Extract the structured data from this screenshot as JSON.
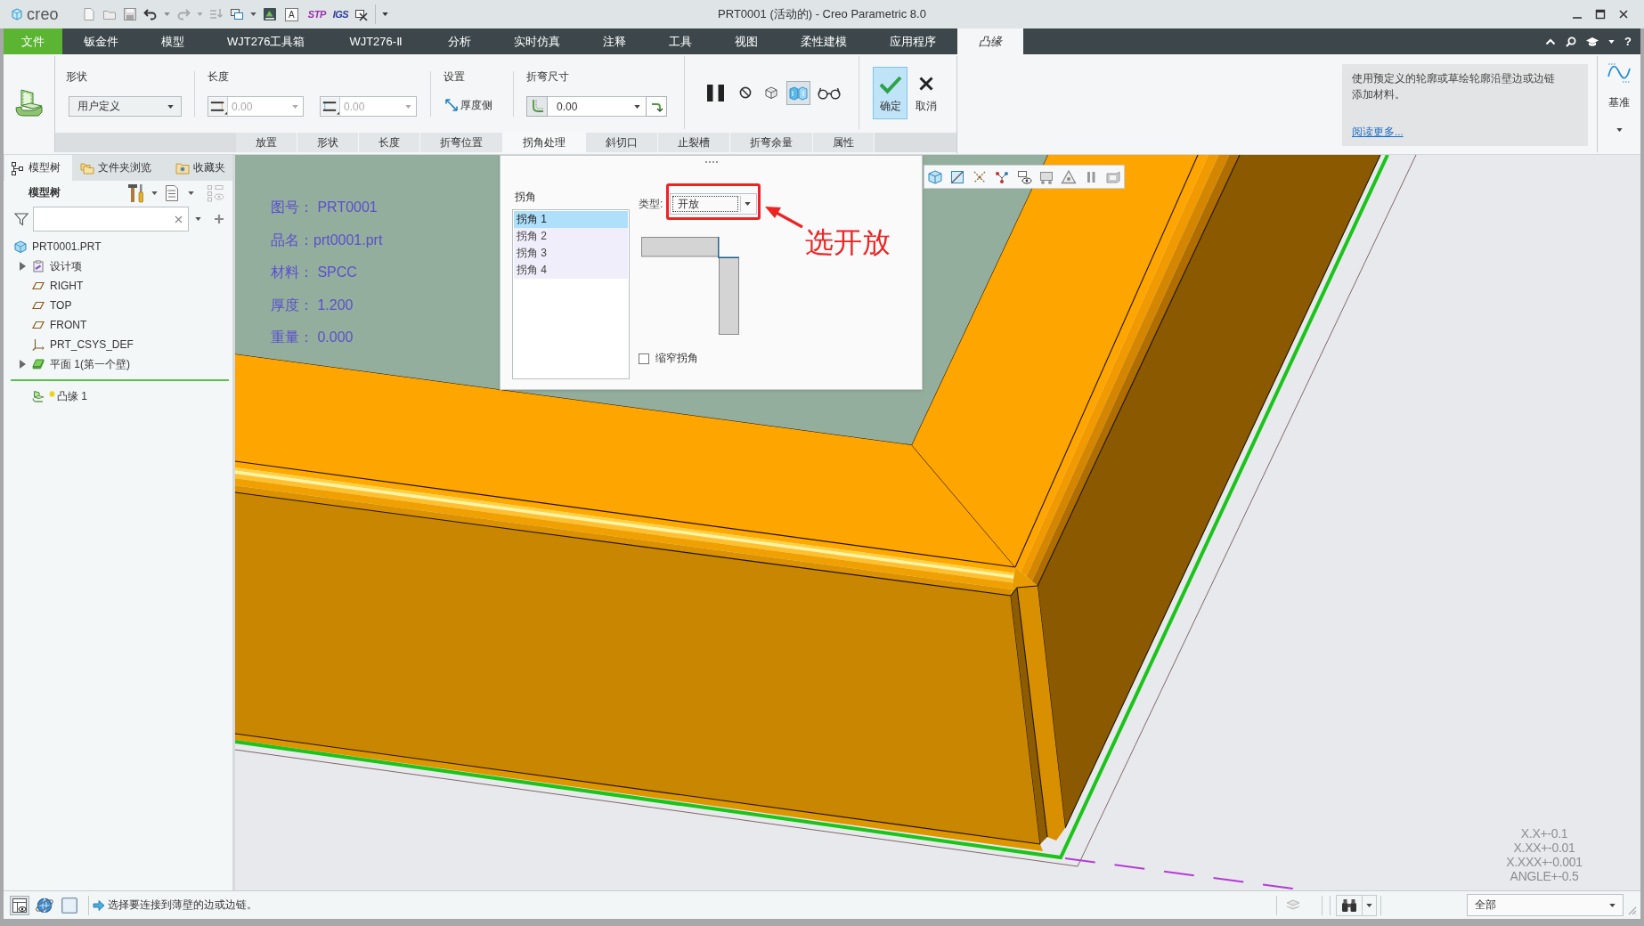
{
  "title_bar": {
    "logo": "creo",
    "quick_access": [
      "A",
      "STP",
      "IGS"
    ],
    "title": "PRT0001 (活动的) - Creo Parametric 8.0"
  },
  "menu_bar": {
    "tabs": [
      {
        "label": "文件",
        "kind": "file",
        "selected": false
      },
      {
        "label": "钣金件",
        "kind": "tab",
        "selected": false
      },
      {
        "label": "模型",
        "kind": "tab",
        "selected": false
      },
      {
        "label": "WJT276工具箱",
        "kind": "tab",
        "selected": false
      },
      {
        "label": "WJT276-Ⅱ",
        "kind": "tab",
        "selected": false
      },
      {
        "label": "分析",
        "kind": "tab",
        "selected": false
      },
      {
        "label": "实时仿真",
        "kind": "tab",
        "selected": false
      },
      {
        "label": "注释",
        "kind": "tab",
        "selected": false
      },
      {
        "label": "工具",
        "kind": "tab",
        "selected": false
      },
      {
        "label": "视图",
        "kind": "tab",
        "selected": false
      },
      {
        "label": "柔性建模",
        "kind": "tab",
        "selected": false
      },
      {
        "label": "应用程序",
        "kind": "tab",
        "selected": false
      },
      {
        "label": "凸缘",
        "kind": "tab",
        "selected": true
      }
    ],
    "help_button": "?"
  },
  "ribbon": {
    "shape": {
      "label": "形状",
      "value": "用户定义"
    },
    "length": {
      "label": "长度",
      "fields": [
        {
          "value": "0.00",
          "disabled": true
        },
        {
          "value": "0.00",
          "disabled": true
        }
      ]
    },
    "settings": {
      "label": "设置",
      "button": "厚度侧"
    },
    "bend_dimension": {
      "label": "折弯尺寸",
      "value": "0.00"
    },
    "tools": [
      {
        "pressed": false
      },
      {
        "pressed": false
      },
      {
        "pressed": false
      },
      {
        "pressed": true
      },
      {
        "pressed": false
      }
    ],
    "ok_button": "确定",
    "cancel_button": "取消",
    "help": {
      "text": "使用预定义的轮廓或草绘轮廓沿壁边或边链添加材料。",
      "link": "阅读更多..."
    },
    "datum": "基准",
    "sub_tabs": [
      {
        "label": "放置",
        "selected": false
      },
      {
        "label": "形状",
        "selected": false
      },
      {
        "label": "长度",
        "selected": false
      },
      {
        "label": "折弯位置",
        "selected": false
      },
      {
        "label": "拐角处理",
        "selected": true
      },
      {
        "label": "斜切口",
        "selected": false
      },
      {
        "label": "止裂槽",
        "selected": false
      },
      {
        "label": "折弯余量",
        "selected": false
      },
      {
        "label": "属性",
        "selected": false
      }
    ]
  },
  "left_panel": {
    "tabs": [
      {
        "label": "模型树",
        "selected": true
      },
      {
        "label": "文件夹浏览",
        "selected": false
      },
      {
        "label": "收藏夹",
        "selected": false
      }
    ],
    "title": "模型树",
    "tree": [
      {
        "label": "PRT0001.PRT",
        "kind": "part",
        "children": [
          {
            "label": "设计项",
            "kind": "items",
            "expanded": false
          },
          {
            "label": "RIGHT",
            "kind": "plane"
          },
          {
            "label": "TOP",
            "kind": "plane"
          },
          {
            "label": "FRONT",
            "kind": "plane"
          },
          {
            "label": "PRT_CSYS_DEF",
            "kind": "csys"
          },
          {
            "label": "平面 1(第一个壁)",
            "kind": "wall",
            "expanded": false
          },
          {
            "kind": "marker"
          },
          {
            "label": "凸缘 1",
            "kind": "flange"
          }
        ]
      }
    ]
  },
  "graphics": {
    "notes": [
      "图号： PRT0001",
      "品名：prt0001.prt",
      "材料： SPCC",
      "厚度： 1.200",
      "重量： 0.000"
    ],
    "tolerances": [
      "X.X+-0.1",
      "X.XX+-0.01",
      "X.XXX+-0.001",
      "ANGLE+-0.5"
    ]
  },
  "dialog": {
    "list_label": "拐角",
    "corners": [
      {
        "label": "拐角 1",
        "selected": true
      },
      {
        "label": "拐角 2",
        "selected": false
      },
      {
        "label": "拐角 3",
        "selected": false
      },
      {
        "label": "拐角 4",
        "selected": false
      }
    ],
    "type_label": "类型:",
    "type_value": "开放",
    "narrow_corner": {
      "label": "缩窄拐角",
      "checked": false
    }
  },
  "callout": {
    "text": "选开放"
  },
  "status_bar": {
    "toggles": [
      {
        "pressed": true
      },
      {
        "pressed": false
      },
      {
        "pressed": false
      }
    ],
    "message": "选择要连接到薄壁的边或边链。",
    "filter": "全部"
  }
}
